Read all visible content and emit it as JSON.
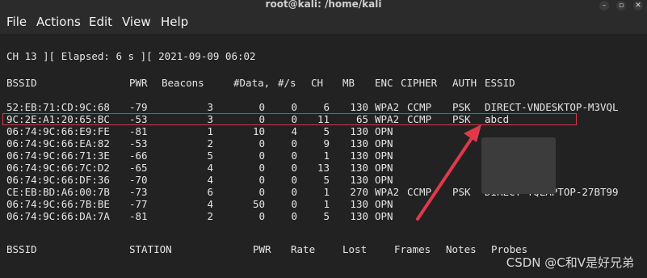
{
  "window": {
    "title": "root@kali: /home/kali",
    "controls": [
      "–",
      "▫",
      "✕"
    ]
  },
  "menu": [
    "File",
    "Actions",
    "Edit",
    "View",
    "Help"
  ],
  "status_line": "CH 13 ][ Elapsed: 6 s ][ 2021-09-09 06:02",
  "ap_headers": {
    "bssid": "BSSID",
    "pwr": "PWR",
    "beacons": "Beacons",
    "data": "#Data,",
    "rate": "#/s",
    "ch": "CH",
    "mb": "MB",
    "enc": "ENC",
    "cipher": "CIPHER",
    "auth": "AUTH",
    "essid": "ESSID"
  },
  "access_points": [
    {
      "bssid": "52:EB:71:CD:9C:68",
      "pwr": "-79",
      "beacons": "3",
      "data": "0",
      "rate": "0",
      "ch": "6",
      "mb": "130",
      "enc": "WPA2",
      "cipher": "CCMP",
      "auth": "PSK",
      "essid": "DIRECT-VNDESKTOP-M3VQL"
    },
    {
      "bssid": "9C:2E:A1:20:65:BC",
      "pwr": "-53",
      "beacons": "3",
      "data": "0",
      "rate": "0",
      "ch": "11",
      "mb": "65",
      "enc": "WPA2",
      "cipher": "CCMP",
      "auth": "PSK",
      "essid": "abcd"
    },
    {
      "bssid": "06:74:9C:66:E9:FE",
      "pwr": "-81",
      "beacons": "1",
      "data": "10",
      "rate": "4",
      "ch": "5",
      "mb": "130",
      "enc": "OPN",
      "cipher": "",
      "auth": "",
      "essid": ""
    },
    {
      "bssid": "06:74:9C:66:EA:82",
      "pwr": "-53",
      "beacons": "2",
      "data": "0",
      "rate": "0",
      "ch": "9",
      "mb": "130",
      "enc": "OPN",
      "cipher": "",
      "auth": "",
      "essid": ""
    },
    {
      "bssid": "06:74:9C:66:71:3E",
      "pwr": "-66",
      "beacons": "5",
      "data": "0",
      "rate": "0",
      "ch": "1",
      "mb": "130",
      "enc": "OPN",
      "cipher": "",
      "auth": "",
      "essid": ""
    },
    {
      "bssid": "06:74:9C:66:7C:D2",
      "pwr": "-65",
      "beacons": "4",
      "data": "0",
      "rate": "0",
      "ch": "13",
      "mb": "130",
      "enc": "OPN",
      "cipher": "",
      "auth": "",
      "essid": ""
    },
    {
      "bssid": "06:74:9C:66:DF:36",
      "pwr": "-70",
      "beacons": "4",
      "data": "0",
      "rate": "0",
      "ch": "5",
      "mb": "130",
      "enc": "OPN",
      "cipher": "",
      "auth": "",
      "essid": ""
    },
    {
      "bssid": "CE:EB:BD:A6:00:7B",
      "pwr": "-73",
      "beacons": "6",
      "data": "0",
      "rate": "0",
      "ch": "1",
      "mb": "270",
      "enc": "WPA2",
      "cipher": "CCMP",
      "auth": "PSK",
      "essid": "DIRECT-YQLAPTOP-27BT99"
    },
    {
      "bssid": "06:74:9C:66:7B:BE",
      "pwr": "-77",
      "beacons": "4",
      "data": "50",
      "rate": "0",
      "ch": "1",
      "mb": "130",
      "enc": "OPN",
      "cipher": "",
      "auth": "",
      "essid": ""
    },
    {
      "bssid": "06:74:9C:66:DA:7A",
      "pwr": "-81",
      "beacons": "2",
      "data": "0",
      "rate": "0",
      "ch": "5",
      "mb": "130",
      "enc": "OPN",
      "cipher": "",
      "auth": "",
      "essid": ""
    }
  ],
  "station_headers": {
    "bssid": "BSSID",
    "station": "STATION",
    "pwr": "PWR",
    "rate": "Rate",
    "lost": "Lost",
    "frames": "Frames",
    "notes": "Notes",
    "probes": "Probes"
  },
  "watermark": "CSDN @C和V是好兄弟",
  "colors": {
    "background": "#222222",
    "text": "#e6e6e6",
    "highlight_box": "#d7374a",
    "arrow": "#e03a4a"
  }
}
